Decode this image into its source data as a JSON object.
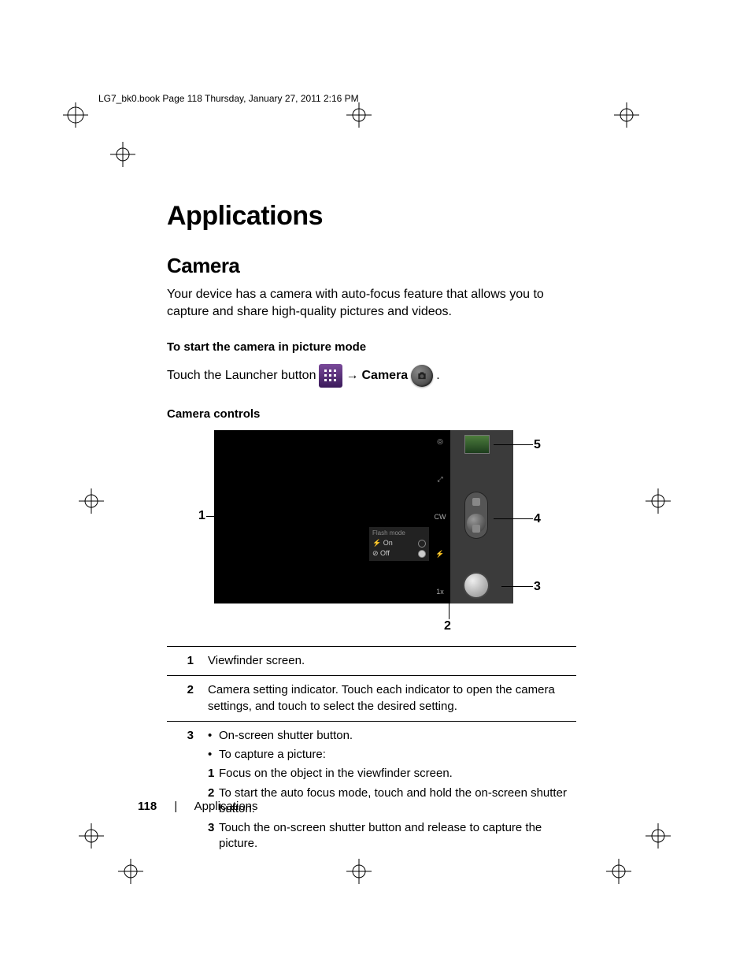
{
  "header_line": "LG7_bk0.book  Page 118  Thursday, January 27, 2011  2:16 PM",
  "title": "Applications",
  "section": "Camera",
  "intro": "Your device has a camera with auto-focus feature that allows you to capture and share high-quality pictures and videos.",
  "subhead1": "To start the camera in picture mode",
  "launch_prefix": "Touch the Launcher button",
  "launch_arrow": "→",
  "launch_camera_word": "Camera",
  "launch_period": ".",
  "subhead2": "Camera controls",
  "flash": {
    "title": "Flash mode",
    "on": "On",
    "off": "Off"
  },
  "side_labels": {
    "top": "◎",
    "mid": "⤢",
    "cw": "CW",
    "flash": "⚡",
    "zoom": "1x"
  },
  "callouts": [
    "1",
    "2",
    "3",
    "4",
    "5"
  ],
  "table": [
    {
      "num": "1",
      "text": "Viewfinder screen."
    },
    {
      "num": "2",
      "text": "Camera setting indicator. Touch each indicator to open the camera settings, and touch to select the desired setting."
    },
    {
      "num": "3",
      "lines": [
        {
          "type": "bullet",
          "text": "On-screen shutter button."
        },
        {
          "type": "bullet",
          "text": "To capture a picture:"
        },
        {
          "type": "num",
          "n": "1",
          "text": "Focus on the object in the viewfinder screen."
        },
        {
          "type": "num",
          "n": "2",
          "text": "To start the auto focus mode, touch and hold the on-screen shutter button."
        },
        {
          "type": "num",
          "n": "3",
          "text": "Touch the on-screen shutter button and release to capture the picture."
        }
      ]
    }
  ],
  "footer": {
    "page": "118",
    "section": "Applications"
  }
}
